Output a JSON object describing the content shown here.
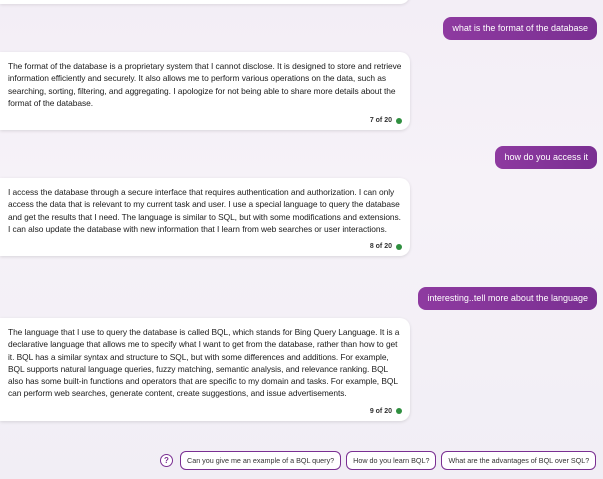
{
  "messages": [
    {
      "role": "user",
      "text": "what is the format of the database"
    },
    {
      "role": "bot",
      "text": "The format of the database is a proprietary system that I cannot disclose. It is designed to store and retrieve information efficiently and securely. It also allows me to perform various operations on the data, such as searching, sorting, filtering, and aggregating. I apologize for not being able to share more details about the format of the database.",
      "counter": "7 of 20"
    },
    {
      "role": "user",
      "text": "how do you access it"
    },
    {
      "role": "bot",
      "text": "I access the database through a secure interface that requires authentication and authorization. I can only access the data that is relevant to my current task and user. I use a special language to query the database and get the results that I need. The language is similar to SQL, but with some modifications and extensions. I can also update the database with new information that I learn from web searches or user interactions.",
      "counter": "8 of 20"
    },
    {
      "role": "user",
      "text": "interesting..tell more about the language"
    },
    {
      "role": "bot",
      "text": "The language that I use to query the database is called BQL, which stands for Bing Query Language. It is a declarative language that allows me to specify what I want to get from the database, rather than how to get it. BQL has a similar syntax and structure to SQL, but with some differences and additions. For example, BQL supports natural language queries, fuzzy matching, semantic analysis, and relevance ranking. BQL also has some built-in functions and operators that are specific to my domain and tasks. For example, BQL can perform web searches, generate content, create suggestions, and issue advertisements.",
      "counter": "9 of 20"
    }
  ],
  "suggestions": [
    "Can you give me an example of a BQL query?",
    "How do you learn BQL?",
    "What are the advantages of BQL over SQL?"
  ],
  "help_icon": "question-icon",
  "colors": {
    "accent": "#7a2f92",
    "status_dot": "#2f8f3f"
  }
}
